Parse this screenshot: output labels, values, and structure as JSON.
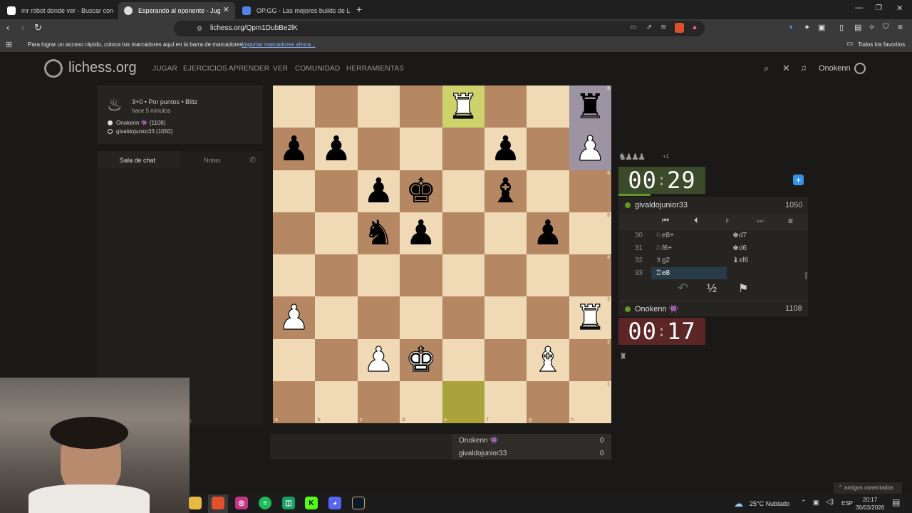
{
  "browser": {
    "tabs": [
      {
        "title": "mr robot donde ver - Buscar con Go",
        "active": false
      },
      {
        "title": "Esperando al oponente - Jug",
        "active": true
      },
      {
        "title": "OP.GG - Las mejores builds de LoL y",
        "active": false
      }
    ],
    "url": "lichess.org/Qpm1DubBe2lK",
    "bookmarks_hint": "Para lograr un acceso rápido, coloca tus marcadores aquí en la barra de marcadores.",
    "import_link": "Importar marcadores ahora...",
    "all_favorites": "Todos los favoritos"
  },
  "site": {
    "logo_text": "lichess.org",
    "nav": [
      "JUGAR",
      "EJERCICIOS",
      "APRENDER",
      "VER",
      "COMUNIDAD",
      "HERRAMIENTAS"
    ],
    "username": "Onokenn"
  },
  "game_info": {
    "mode": "3+0 • Por puntos • Blitz",
    "time_ago": "hace 5 minutos",
    "white_player": "Onokenn 👾 (1108)",
    "black_player": "givaldojunior33 (1050)"
  },
  "chat": {
    "tab_chat": "Sala de chat",
    "tab_notes": "Notas",
    "partial_text": "nt"
  },
  "board": {
    "ranks": [
      [
        "",
        "",
        "",
        "",
        "wR",
        "",
        "",
        "bR"
      ],
      [
        "bP",
        "bP",
        "",
        "",
        "",
        "bP",
        "",
        "wP"
      ],
      [
        "",
        "",
        "bP",
        "bK",
        "",
        "bB",
        "",
        ""
      ],
      [
        "",
        "",
        "bN",
        "bP",
        "",
        "",
        "bP",
        ""
      ],
      [
        "",
        "",
        "",
        "",
        "",
        "",
        "",
        ""
      ],
      [
        "wP",
        "",
        "",
        "",
        "",
        "",
        "",
        "wR"
      ],
      [
        "",
        "",
        "wP",
        "wK",
        "",
        "",
        "wB",
        ""
      ],
      [
        "",
        "",
        "",
        "",
        "",
        "",
        "",
        ""
      ]
    ],
    "highlight": [
      "e8",
      "e1"
    ],
    "selected": [
      "h8",
      "h7"
    ],
    "rank_labels": [
      "8",
      "7",
      "6",
      "5",
      "4",
      "3",
      "2",
      "1"
    ],
    "file_labels": [
      "a",
      "b",
      "c",
      "d",
      "e",
      "f",
      "g",
      "h"
    ]
  },
  "opponent": {
    "material": "♞♟♟♟",
    "material_diff": "+1",
    "clock_min": "00",
    "clock_sep": ":",
    "clock_sec": "29",
    "name": "givaldojunior33",
    "rating": "1050"
  },
  "moves": [
    {
      "num": "30",
      "white": "♘e8+",
      "black": "♚d7"
    },
    {
      "num": "31",
      "white": "♘f6+",
      "black": "♚d6"
    },
    {
      "num": "32",
      "white": "♗g2",
      "black": "♝xf6"
    },
    {
      "num": "33",
      "white": "♖e8",
      "black": ""
    }
  ],
  "controls": {
    "first": "⏮",
    "prev": "⏴",
    "next": "⏵",
    "last": "⏭",
    "menu": "≡",
    "takeback": "↶",
    "draw": "½",
    "resign": "⚑"
  },
  "player": {
    "name": "Onokenn 👾",
    "rating": "1108",
    "clock_min": "00",
    "clock_sep": ":",
    "clock_sec": "17",
    "material": "♜"
  },
  "scores": [
    {
      "name": "Onokenn 👾",
      "score": "0"
    },
    {
      "name": "givaldojunior33",
      "score": "0"
    }
  ],
  "taskbar": {
    "weather": "25°C  Nublado",
    "lang": "ESP",
    "time": "20:17",
    "date": "30/03/2026",
    "friends": "⌃ amigos conectados"
  },
  "colors": {
    "light_square": "#f0d9b5",
    "dark_square": "#b58863",
    "clock_active": "#3a4a2a",
    "clock_low": "#5c2626",
    "online_dot": "#629924"
  }
}
